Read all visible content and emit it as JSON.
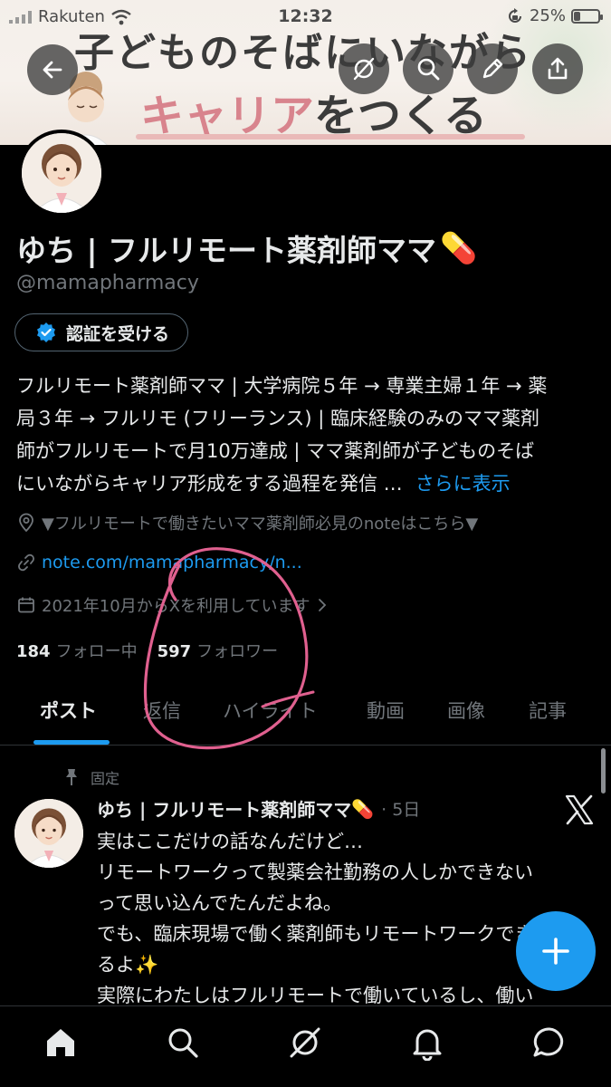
{
  "status_bar": {
    "carrier": "Rakuten",
    "time": "12:32",
    "battery": "25%",
    "battery_level": 0.25
  },
  "banner": {
    "line1": "子どものそばにいながら",
    "line2_pink": "キャリア",
    "line2_dark": "をつくる"
  },
  "header_actions": {
    "back": "back-arrow-icon",
    "grok": "grok-icon",
    "search": "search-icon",
    "edit": "edit-icon",
    "share": "share-icon"
  },
  "profile": {
    "display_name": "ゆち | フルリモート薬剤師ママ",
    "name_emoji": "💊",
    "handle": "@mamapharmacy",
    "verify_button": "認証を受ける",
    "bio_lines": [
      "フルリモート薬剤師ママ | 大学病院５年 → 専業主婦１年 → 薬",
      "局３年 → フルリモ (フリーランス) | 臨床経験のみのママ薬剤",
      "師がフルリモートで月10万達成 | ママ薬剤師が子どものそば",
      "にいながらキャリア形成をする過程を発信 …"
    ],
    "show_more": "さらに表示",
    "location": "▼フルリモートで働きたいママ薬剤師必見のnoteはこちら▼",
    "link": "note.com/mamapharmacy/n...",
    "joined": "2021年10月からXを利用しています",
    "following_count": "184",
    "following_label": "フォロー中",
    "followers_count": "597",
    "followers_label": "フォロワー"
  },
  "tabs": [
    "ポスト",
    "返信",
    "ハイライト",
    "動画",
    "画像",
    "記事"
  ],
  "active_tab": 0,
  "post": {
    "pinned_label": "固定",
    "author": "ゆち | フルリモート薬剤師ママ",
    "author_emoji": "💊",
    "time": "· 5日",
    "lines": [
      "実はここだけの話なんだけど…",
      "リモートワークって製薬会社勤務の人しかできない",
      "って思い込んでたんだよね。",
      "でも、臨床現場で働く薬剤師もリモートワークでき",
      "るよ✨",
      "実際にわたしはフルリモートで働いているし、働い"
    ]
  },
  "fab": {
    "label": "+",
    "icon": "plus-icon"
  },
  "bottom_nav": [
    "home-icon",
    "search-icon",
    "grok-icon",
    "notifications-icon",
    "messages-icon"
  ],
  "colors": {
    "accent": "#1d9bf0",
    "muted": "#71767b",
    "annotation": "#e0608f",
    "banner_pink": "#d8848d"
  }
}
